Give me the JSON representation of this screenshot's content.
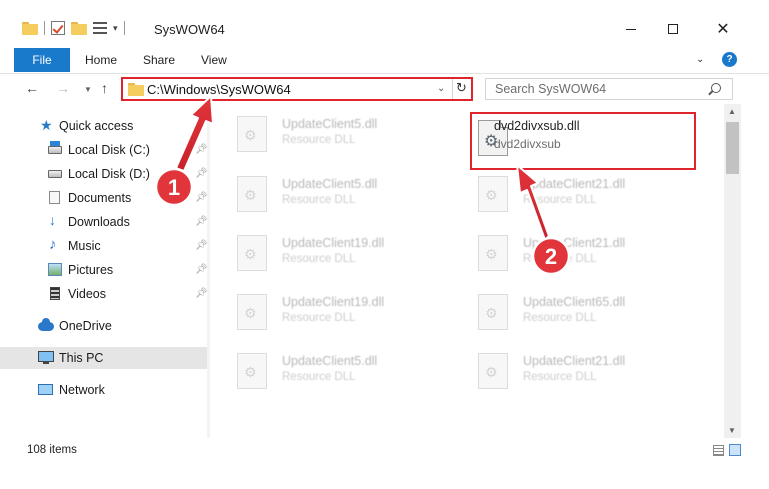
{
  "window": {
    "title": "SysWOW64"
  },
  "ribbon": {
    "tabs": {
      "file": "File",
      "home": "Home",
      "share": "Share",
      "view": "View"
    }
  },
  "navigation": {
    "address_path": "C:\\Windows\\SysWOW64",
    "search_placeholder": "Search SysWOW64"
  },
  "sidebar": {
    "quick_access": "Quick access",
    "items": [
      {
        "label": "Local Disk (C:)",
        "icon": "local-disk-icon",
        "pinned": true
      },
      {
        "label": "Local Disk (D:)",
        "icon": "local-disk-icon",
        "pinned": true
      },
      {
        "label": "Documents",
        "icon": "documents-icon",
        "pinned": true
      },
      {
        "label": "Downloads",
        "icon": "download-arrow-icon",
        "pinned": true
      },
      {
        "label": "Music",
        "icon": "music-note-icon",
        "pinned": true
      },
      {
        "label": "Pictures",
        "icon": "picture-icon",
        "pinned": true
      },
      {
        "label": "Videos",
        "icon": "film-icon",
        "pinned": true
      }
    ],
    "onedrive": "OneDrive",
    "this_pc": "This PC",
    "network": "Network"
  },
  "files": {
    "highlighted": {
      "name": "dvd2divxsub.dll",
      "description": "dvd2divxsub"
    },
    "left_column": [
      {
        "name": "UpdateClient5.dll",
        "type": "Resource DLL"
      },
      {
        "name": "UpdateClient5.dll",
        "type": "Resource DLL"
      },
      {
        "name": "UpdateClient19.dll",
        "type": "Resource DLL"
      },
      {
        "name": "UpdateClient19.dll",
        "type": "Resource DLL"
      },
      {
        "name": "UpdateClient5.dll",
        "type": "Resource DLL"
      }
    ],
    "right_column": [
      {
        "name": "UpdateClient21.dll",
        "type": "Resource DLL"
      },
      {
        "name": "UpdateClient21.dll",
        "type": "Resource DLL"
      },
      {
        "name": "UpdateClient65.dll",
        "type": "Resource DLL"
      },
      {
        "name": "UpdateClient21.dll",
        "type": "Resource DLL"
      }
    ]
  },
  "status": {
    "item_count": "108 items"
  },
  "annotations": {
    "step1": "1",
    "step2": "2",
    "highlight_color": "#e0242e"
  },
  "colors": {
    "accent": "#1979ca"
  }
}
